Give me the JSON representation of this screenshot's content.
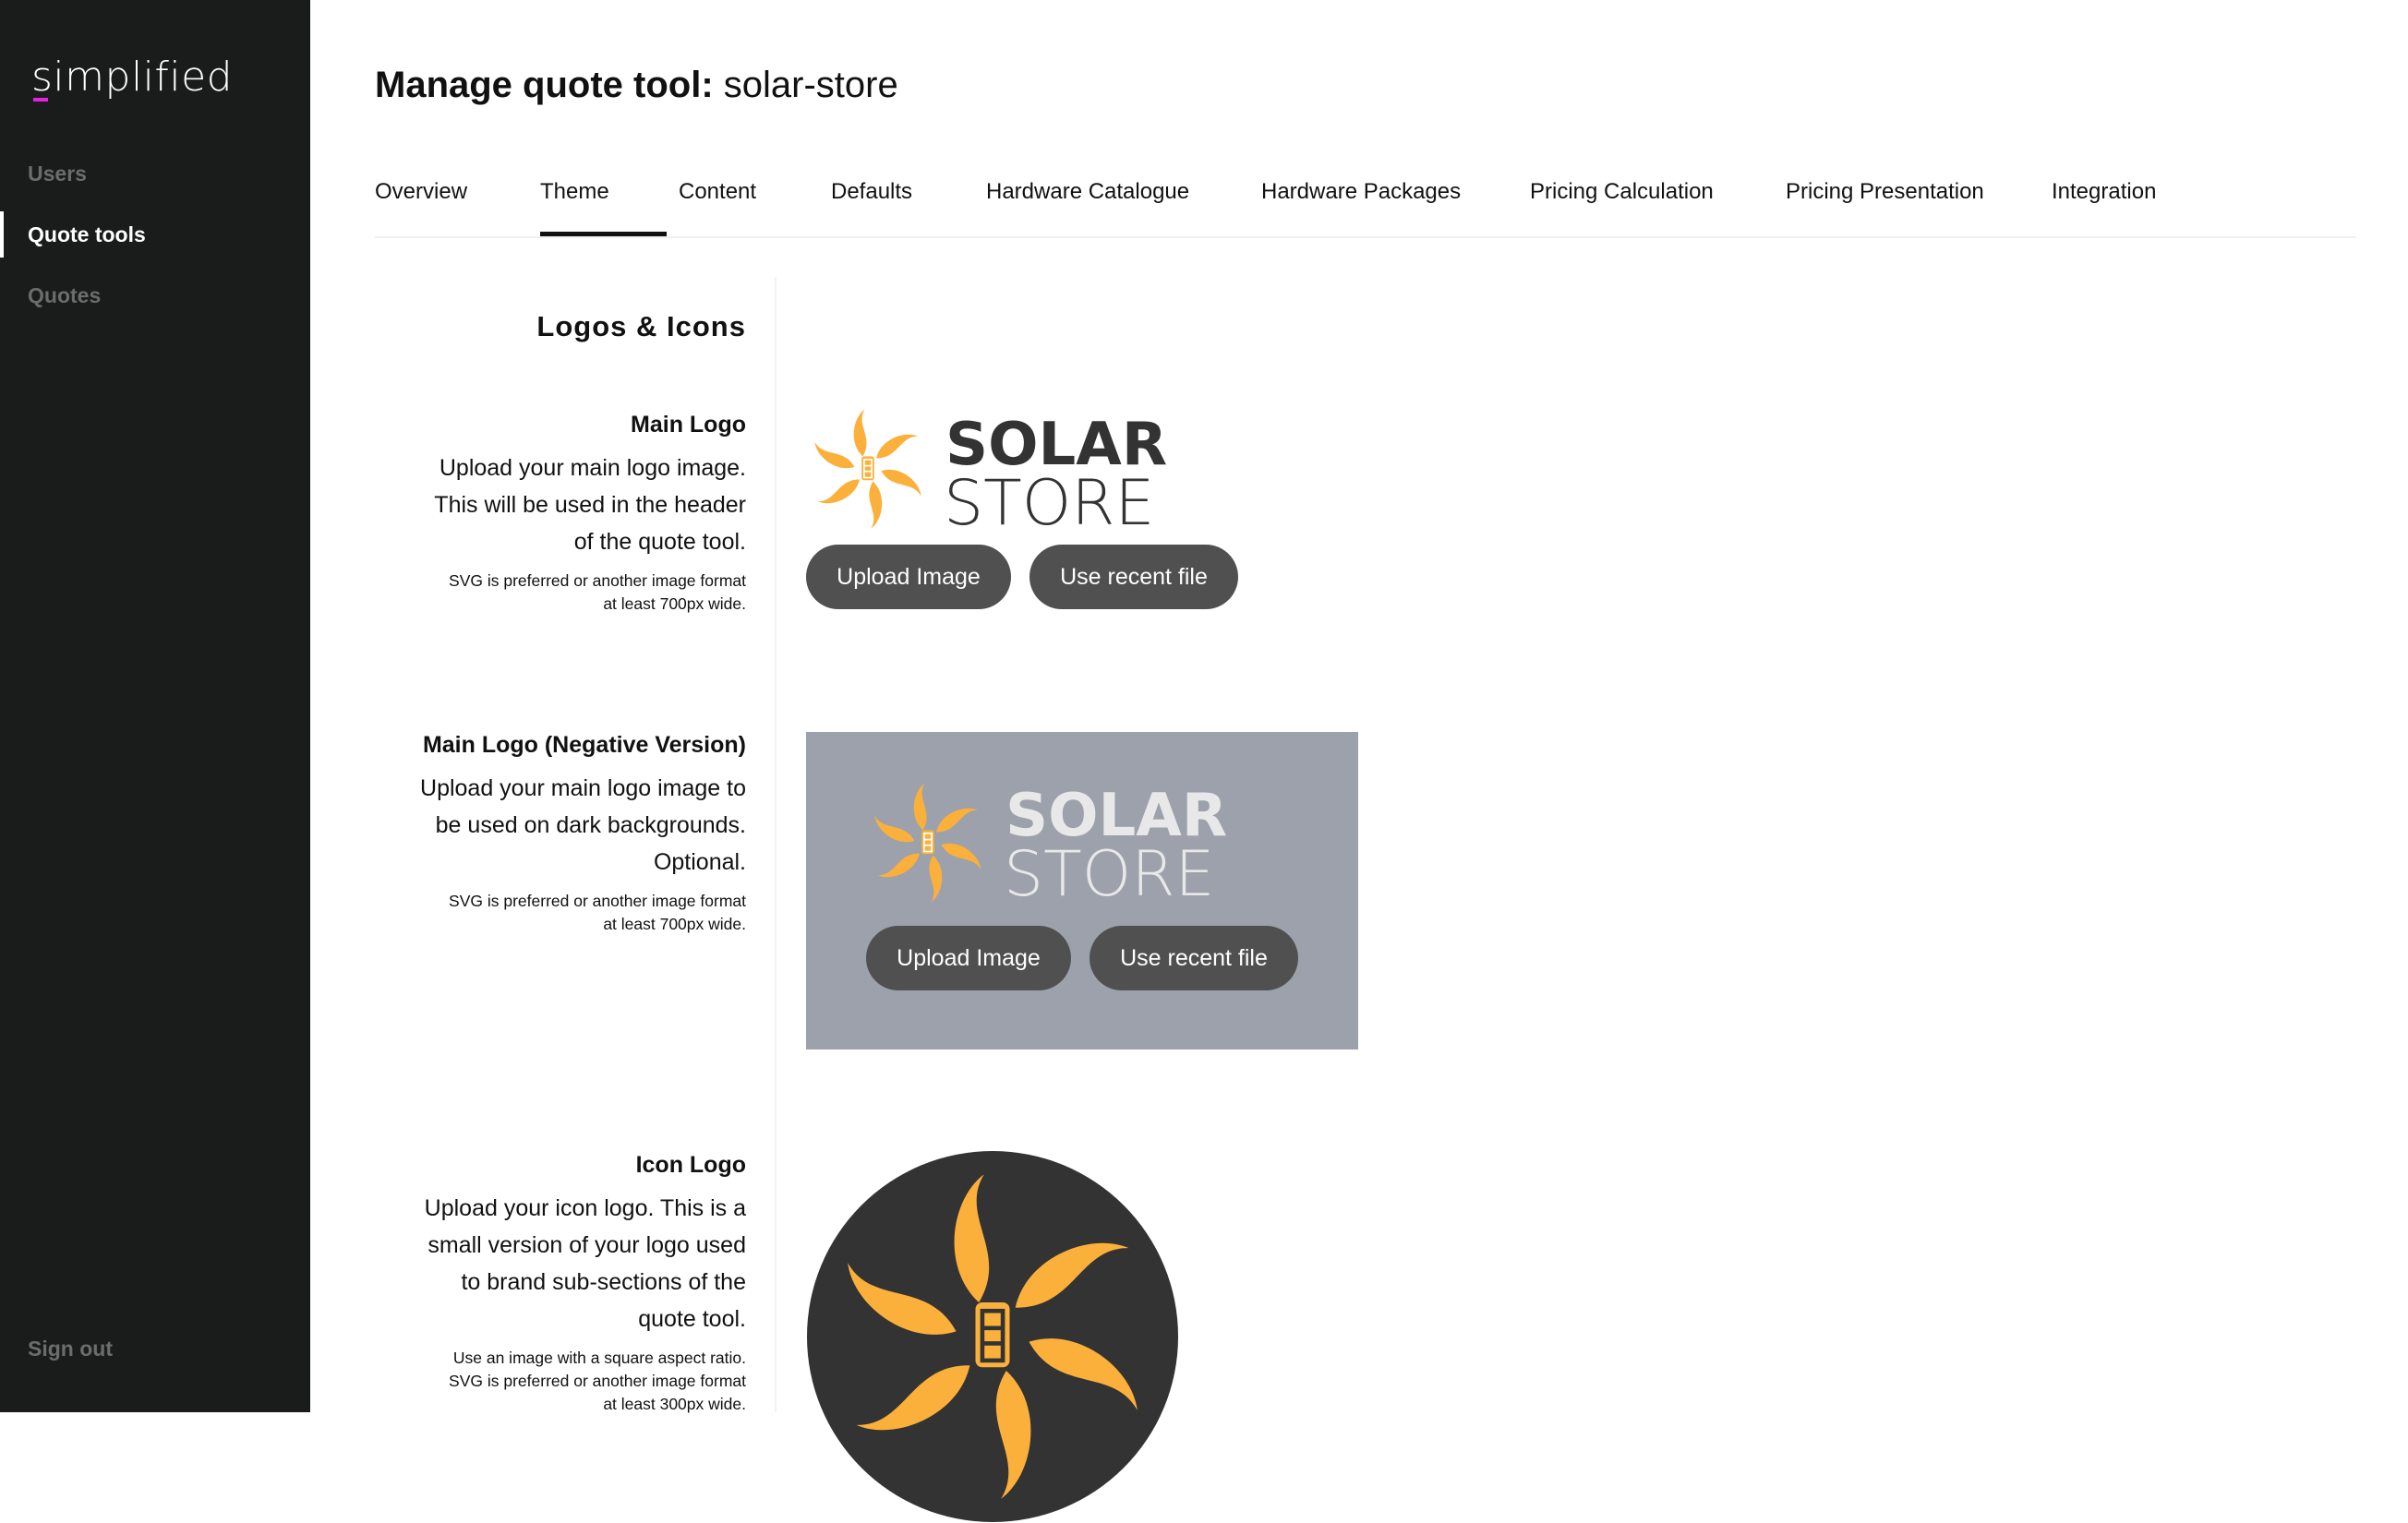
{
  "sidebar": {
    "brand": "simplified",
    "items": [
      {
        "label": "Users"
      },
      {
        "label": "Quote tools",
        "active": true
      },
      {
        "label": "Quotes"
      }
    ],
    "sign_out": "Sign out"
  },
  "header": {
    "title_bold": "Manage quote tool:",
    "title_name": "solar-store"
  },
  "tabs": [
    {
      "label": "Overview"
    },
    {
      "label": "Theme",
      "active": true
    },
    {
      "label": "Content"
    },
    {
      "label": "Defaults"
    },
    {
      "label": "Hardware Catalogue"
    },
    {
      "label": "Hardware Packages"
    },
    {
      "label": "Pricing Calculation"
    },
    {
      "label": "Pricing Presentation"
    },
    {
      "label": "Integration"
    }
  ],
  "section": {
    "title": "Logos & Icons"
  },
  "main_logo": {
    "title": "Main Logo",
    "desc": [
      "Upload your main logo image.",
      "This will be used in the header",
      "of the quote tool."
    ],
    "note": [
      "SVG is preferred or another image format",
      "at least 700px wide."
    ],
    "upload": "Upload Image",
    "recent": "Use recent file"
  },
  "negative_logo": {
    "title": "Main Logo (Negative Version)",
    "desc": [
      "Upload your main logo image to",
      "be used on dark backgrounds.",
      "Optional."
    ],
    "note": [
      "SVG is preferred or another image format",
      "at least 700px wide."
    ],
    "upload": "Upload Image",
    "recent": "Use recent file"
  },
  "icon_logo": {
    "title": "Icon Logo",
    "desc": [
      "Upload your icon logo. This is a",
      "small version of your logo used",
      "to brand sub-sections of the",
      "quote tool."
    ],
    "note": [
      "Use an image with a square aspect ratio.",
      "SVG is preferred or another image format",
      "at least 300px wide."
    ]
  },
  "logo_text": {
    "line1": "SOLAR",
    "line2": "STORE"
  },
  "colors": {
    "sidebar": "#1a1c1c",
    "accent": "#e61ee6",
    "logo_orange": "#fbb03b",
    "logo_dark": "#333333",
    "button": "#505050",
    "negative_bg": "#9ca1ac"
  }
}
